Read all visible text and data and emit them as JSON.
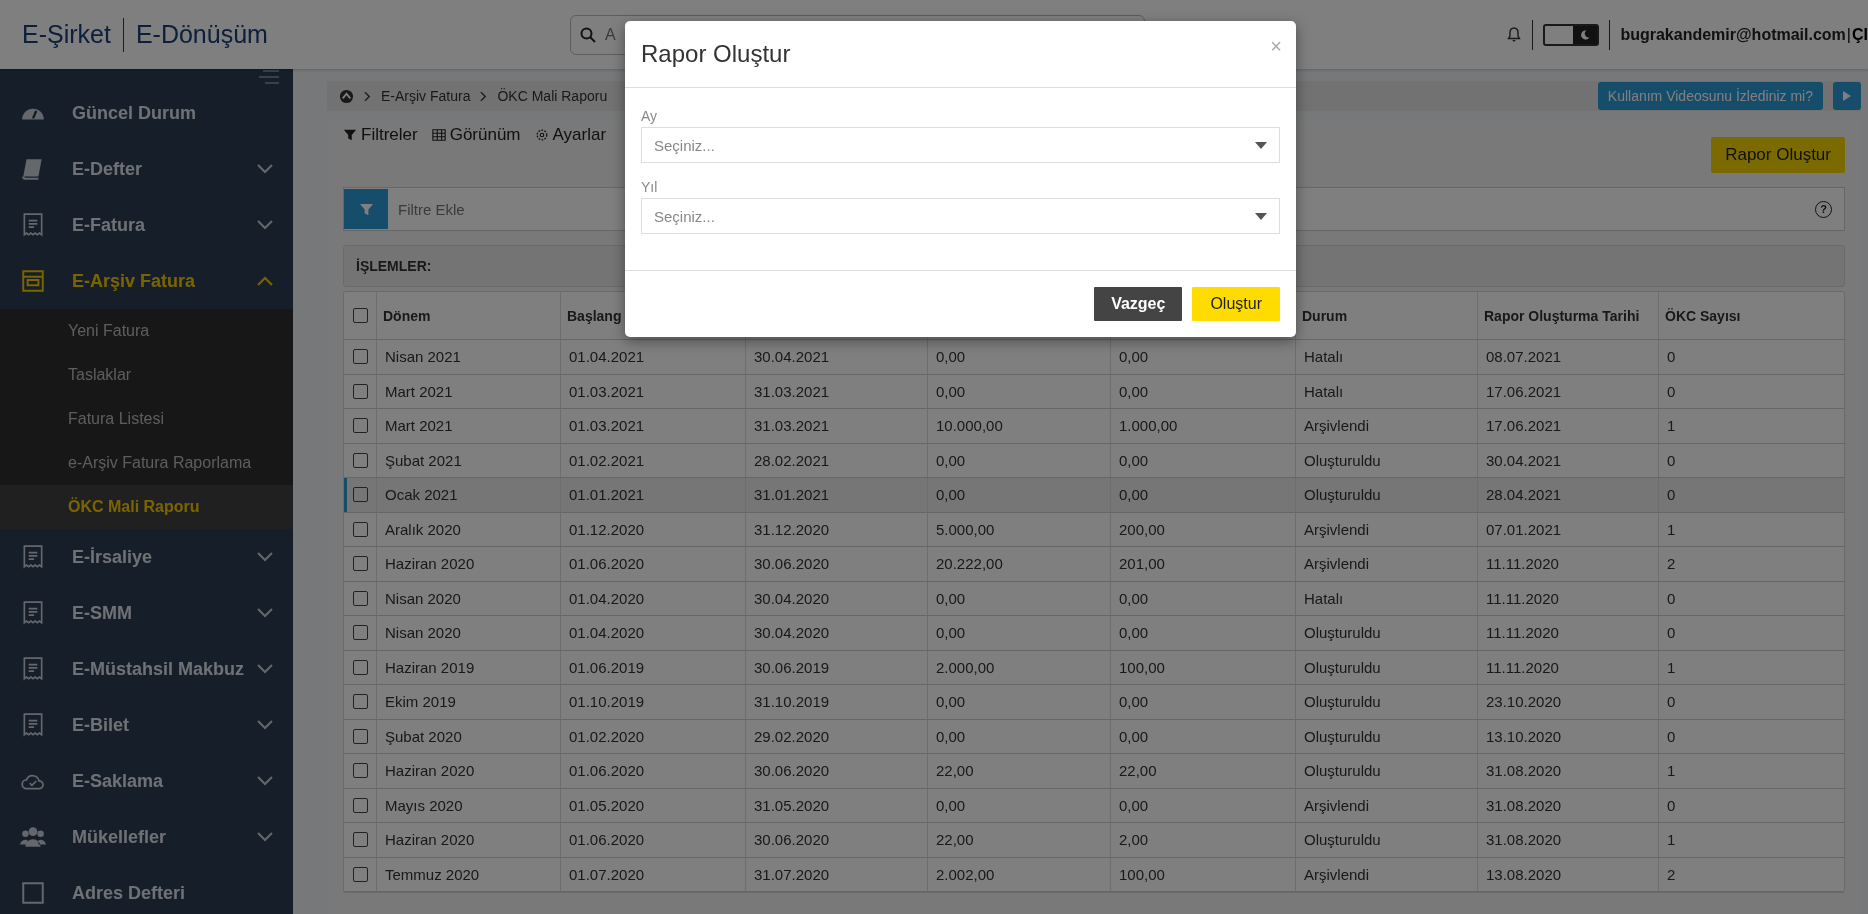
{
  "header": {
    "logo_left": "E-Şirket",
    "logo_right": "E-Dönüşüm",
    "search": {
      "placeholder": "A"
    },
    "dark_mode": {
      "on": true
    },
    "user_email": "bugrakandemir@hotmail.com",
    "separator": "|",
    "logout_partial": "ÇI"
  },
  "sidebar": {
    "items": [
      {
        "label": "Güncel Durum",
        "kind": "link",
        "selected": false
      },
      {
        "label": "E-Defter",
        "kind": "group",
        "expanded": false,
        "selected": false
      },
      {
        "label": "E-Fatura",
        "kind": "group",
        "expanded": false,
        "selected": false
      },
      {
        "label": "E-Arşiv Fatura",
        "kind": "group",
        "expanded": true,
        "selected": true,
        "children": [
          {
            "label": "Yeni Fatura",
            "selected": false
          },
          {
            "label": "Taslaklar",
            "selected": false
          },
          {
            "label": "Fatura Listesi",
            "selected": false
          },
          {
            "label": "e-Arşiv Fatura Raporlama",
            "selected": false
          },
          {
            "label": "ÖKC Mali Raporu",
            "selected": true
          }
        ]
      },
      {
        "label": "E-İrsaliye",
        "kind": "group",
        "expanded": false,
        "selected": false
      },
      {
        "label": "E-SMM",
        "kind": "group",
        "expanded": false,
        "selected": false
      },
      {
        "label": "E-Müstahsil Makbuz",
        "kind": "group",
        "expanded": false,
        "selected": false
      },
      {
        "label": "E-Bilet",
        "kind": "group",
        "expanded": false,
        "selected": false
      },
      {
        "label": "E-Saklama",
        "kind": "group",
        "expanded": false,
        "selected": false
      },
      {
        "label": "Mükellefler",
        "kind": "group",
        "expanded": false,
        "selected": false
      },
      {
        "label": "Adres Defteri",
        "kind": "link",
        "selected": false
      }
    ]
  },
  "breadcrumb": [
    "E-Arşiv Fatura",
    "ÖKC Mali Raporu"
  ],
  "help_video": {
    "label": "Kullanım Videosunu İzlediniz mi?"
  },
  "toolbar": [
    "Filtreler",
    "Görünüm",
    "Ayarlar"
  ],
  "create_report_button": "Rapor Oluştur",
  "filter_bar": {
    "placeholder": "Filtre Ekle",
    "help_icon": "?"
  },
  "actions_label": "İŞLEMLER:",
  "table": {
    "select_all_checked": false,
    "columns": [
      "Dönem",
      "Başlang",
      "",
      "",
      "",
      "Durum",
      "Rapor Oluşturma Tarihi",
      "ÖKC Sayısı"
    ],
    "rows": [
      {
        "cells": [
          "Nisan 2021",
          "01.04.2021",
          "30.04.2021",
          "0,00",
          "0,00",
          "Hatalı",
          "08.07.2021",
          "0"
        ],
        "selected": false,
        "checked": false
      },
      {
        "cells": [
          "Mart 2021",
          "01.03.2021",
          "31.03.2021",
          "0,00",
          "0,00",
          "Hatalı",
          "17.06.2021",
          "0"
        ],
        "selected": false,
        "checked": false
      },
      {
        "cells": [
          "Mart 2021",
          "01.03.2021",
          "31.03.2021",
          "10.000,00",
          "1.000,00",
          "Arşivlendi",
          "17.06.2021",
          "1"
        ],
        "selected": false,
        "checked": false
      },
      {
        "cells": [
          "Şubat 2021",
          "01.02.2021",
          "28.02.2021",
          "0,00",
          "0,00",
          "Oluşturuldu",
          "30.04.2021",
          "0"
        ],
        "selected": false,
        "checked": false
      },
      {
        "cells": [
          "Ocak 2021",
          "01.01.2021",
          "31.01.2021",
          "0,00",
          "0,00",
          "Oluşturuldu",
          "28.04.2021",
          "0"
        ],
        "selected": true,
        "checked": false
      },
      {
        "cells": [
          "Aralık 2020",
          "01.12.2020",
          "31.12.2020",
          "5.000,00",
          "200,00",
          "Arşivlendi",
          "07.01.2021",
          "1"
        ],
        "selected": false,
        "checked": false
      },
      {
        "cells": [
          "Haziran 2020",
          "01.06.2020",
          "30.06.2020",
          "20.222,00",
          "201,00",
          "Arşivlendi",
          "11.11.2020",
          "2"
        ],
        "selected": false,
        "checked": false
      },
      {
        "cells": [
          "Nisan 2020",
          "01.04.2020",
          "30.04.2020",
          "0,00",
          "0,00",
          "Hatalı",
          "11.11.2020",
          "0"
        ],
        "selected": false,
        "checked": false
      },
      {
        "cells": [
          "Nisan 2020",
          "01.04.2020",
          "30.04.2020",
          "0,00",
          "0,00",
          "Oluşturuldu",
          "11.11.2020",
          "0"
        ],
        "selected": false,
        "checked": false
      },
      {
        "cells": [
          "Haziran 2019",
          "01.06.2019",
          "30.06.2019",
          "2.000,00",
          "100,00",
          "Oluşturuldu",
          "11.11.2020",
          "1"
        ],
        "selected": false,
        "checked": false
      },
      {
        "cells": [
          "Ekim 2019",
          "01.10.2019",
          "31.10.2019",
          "0,00",
          "0,00",
          "Oluşturuldu",
          "23.10.2020",
          "0"
        ],
        "selected": false,
        "checked": false
      },
      {
        "cells": [
          "Şubat 2020",
          "01.02.2020",
          "29.02.2020",
          "0,00",
          "0,00",
          "Oluşturuldu",
          "13.10.2020",
          "0"
        ],
        "selected": false,
        "checked": false
      },
      {
        "cells": [
          "Haziran 2020",
          "01.06.2020",
          "30.06.2020",
          "22,00",
          "22,00",
          "Oluşturuldu",
          "31.08.2020",
          "1"
        ],
        "selected": false,
        "checked": false
      },
      {
        "cells": [
          "Mayıs 2020",
          "01.05.2020",
          "31.05.2020",
          "0,00",
          "0,00",
          "Arşivlendi",
          "31.08.2020",
          "0"
        ],
        "selected": false,
        "checked": false
      },
      {
        "cells": [
          "Haziran 2020",
          "01.06.2020",
          "30.06.2020",
          "22,00",
          "2,00",
          "Oluşturuldu",
          "31.08.2020",
          "1"
        ],
        "selected": false,
        "checked": false
      },
      {
        "cells": [
          "Temmuz 2020",
          "01.07.2020",
          "31.07.2020",
          "2.002,00",
          "100,00",
          "Arşivlendi",
          "13.08.2020",
          "2"
        ],
        "selected": false,
        "checked": false
      }
    ]
  },
  "modal": {
    "title": "Rapor Oluştur",
    "close": "×",
    "fields": [
      {
        "label": "Ay",
        "placeholder": "Seçiniz..."
      },
      {
        "label": "Yıl",
        "placeholder": "Seçiniz..."
      }
    ],
    "buttons": [
      {
        "label": "Vazgeç",
        "kind": "secondary"
      },
      {
        "label": "Oluştur",
        "kind": "primary"
      }
    ]
  }
}
